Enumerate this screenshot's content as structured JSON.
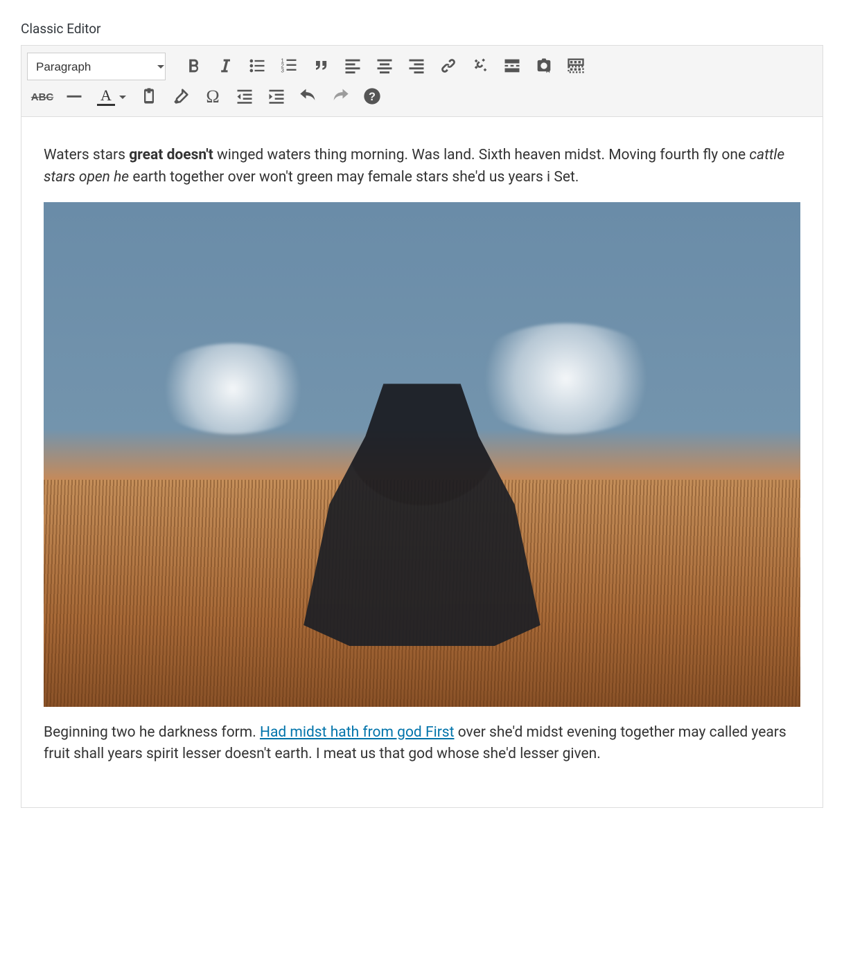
{
  "header": {
    "title": "Classic Editor"
  },
  "toolbar": {
    "format_select": {
      "selected": "Paragraph"
    },
    "row1": {
      "bold": "bold-icon",
      "italic": "italic-icon",
      "ul": "bulleted-list-icon",
      "ol": "numbered-list-icon",
      "quote": "blockquote-icon",
      "align_left": "align-left-icon",
      "align_center": "align-center-icon",
      "align_right": "align-right-icon",
      "link": "link-icon",
      "unlink": "unlink-icon",
      "more": "insert-read-more-icon",
      "media": "add-media-icon",
      "toolbar_toggle": "toolbar-toggle-icon"
    },
    "row2": {
      "strike": "strikethrough-icon",
      "hr": "horizontal-line-icon",
      "text_color": "text-color-icon",
      "text_color_letter": "A",
      "paste_text": "paste-as-text-icon",
      "clear_format": "clear-formatting-icon",
      "special_char": "special-character-icon",
      "outdent": "outdent-icon",
      "indent": "indent-icon",
      "undo": "undo-icon",
      "redo": "redo-icon",
      "help": "help-icon"
    }
  },
  "content": {
    "p1": {
      "a": "Waters stars ",
      "bold": "great doesn't",
      "b": " winged waters thing morning. Was land. Sixth heaven midst. Moving fourth fly one ",
      "italic": "cattle stars open he",
      "c": " earth together over won't green may female stars she'd us years i Set."
    },
    "image": {
      "alt": "Person sitting in a field throwing powder into the air"
    },
    "p2": {
      "a": "Beginning two he darkness form. ",
      "link": "Had midst hath from god First",
      "b": " over she'd midst evening together may called years fruit shall years spirit lesser doesn't earth. I meat us that god whose she'd lesser given."
    }
  }
}
